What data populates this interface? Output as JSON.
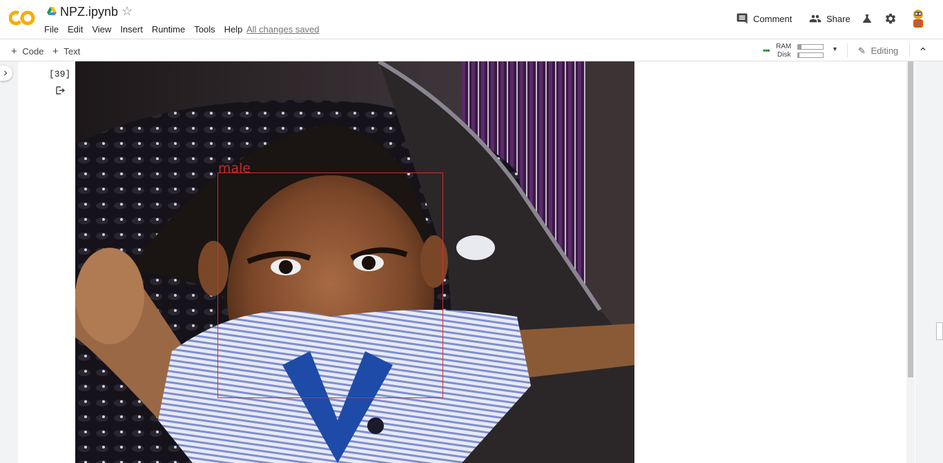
{
  "header": {
    "notebook_title": "NPZ.ipynb",
    "menu": [
      "File",
      "Edit",
      "View",
      "Insert",
      "Runtime",
      "Tools",
      "Help"
    ],
    "save_status": "All changes saved",
    "comment_label": "Comment",
    "share_label": "Share"
  },
  "toolbar": {
    "add_code_label": "Code",
    "add_text_label": "Text",
    "ram_label": "RAM",
    "disk_label": "Disk",
    "ram_usage": 0.15,
    "disk_usage": 0.05,
    "editing_label": "Editing"
  },
  "cell": {
    "execution_count": "[39]",
    "detection_label": "male"
  },
  "colors": {
    "logo_orange": "#f9ab00",
    "detection_red": "#d32f2f",
    "status_green": "#1e8e3e"
  }
}
